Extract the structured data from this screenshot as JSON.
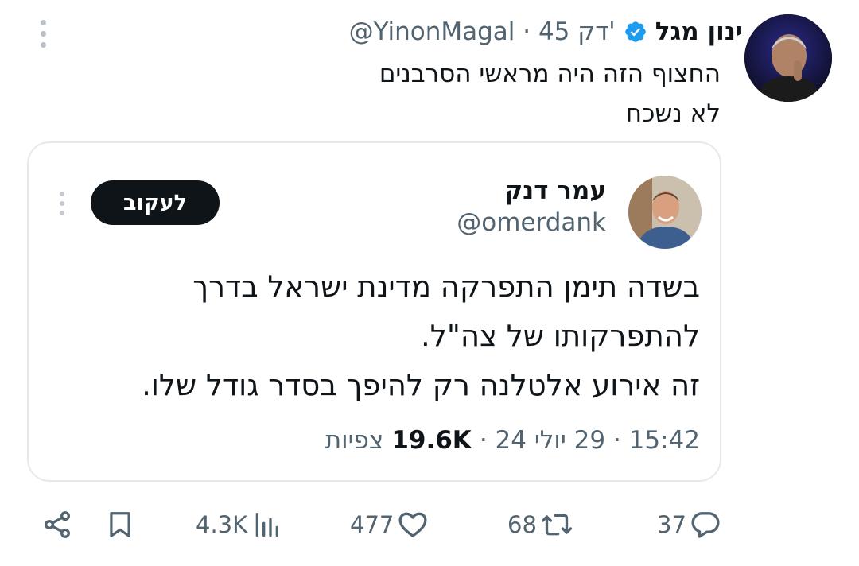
{
  "tweet": {
    "author_name": "ינון מגל",
    "meta": "@YinonMagal · 45 דק'",
    "text": "החצוף הזה היה מראשי הסרבנים\nלא נשכח"
  },
  "quote": {
    "author_name": "עמר דנק",
    "handle": "@omerdank",
    "follow_label": "לעקוב",
    "text": "בשדה תימן התפרקה מדינת ישראל בדרך\nלהתפרקותו של צה\"ל.\nזה אירוע אלטלנה רק להיפך בסדר גודל שלו.",
    "time_date": "15:42 · 29 יולי 24 ·",
    "views_count": "19.6K",
    "views_label": "צפיות"
  },
  "actions": {
    "replies": "37",
    "reposts": "68",
    "likes": "477",
    "views": "4.3K"
  },
  "colors": {
    "verified": "#1d9bf0",
    "text": "#0f1419",
    "secondary": "#536471",
    "border": "#e6e9ec"
  },
  "icons": [
    "more-icon",
    "verified-icon",
    "reply-icon",
    "repost-icon",
    "like-icon",
    "views-icon",
    "bookmark-icon",
    "share-icon"
  ]
}
